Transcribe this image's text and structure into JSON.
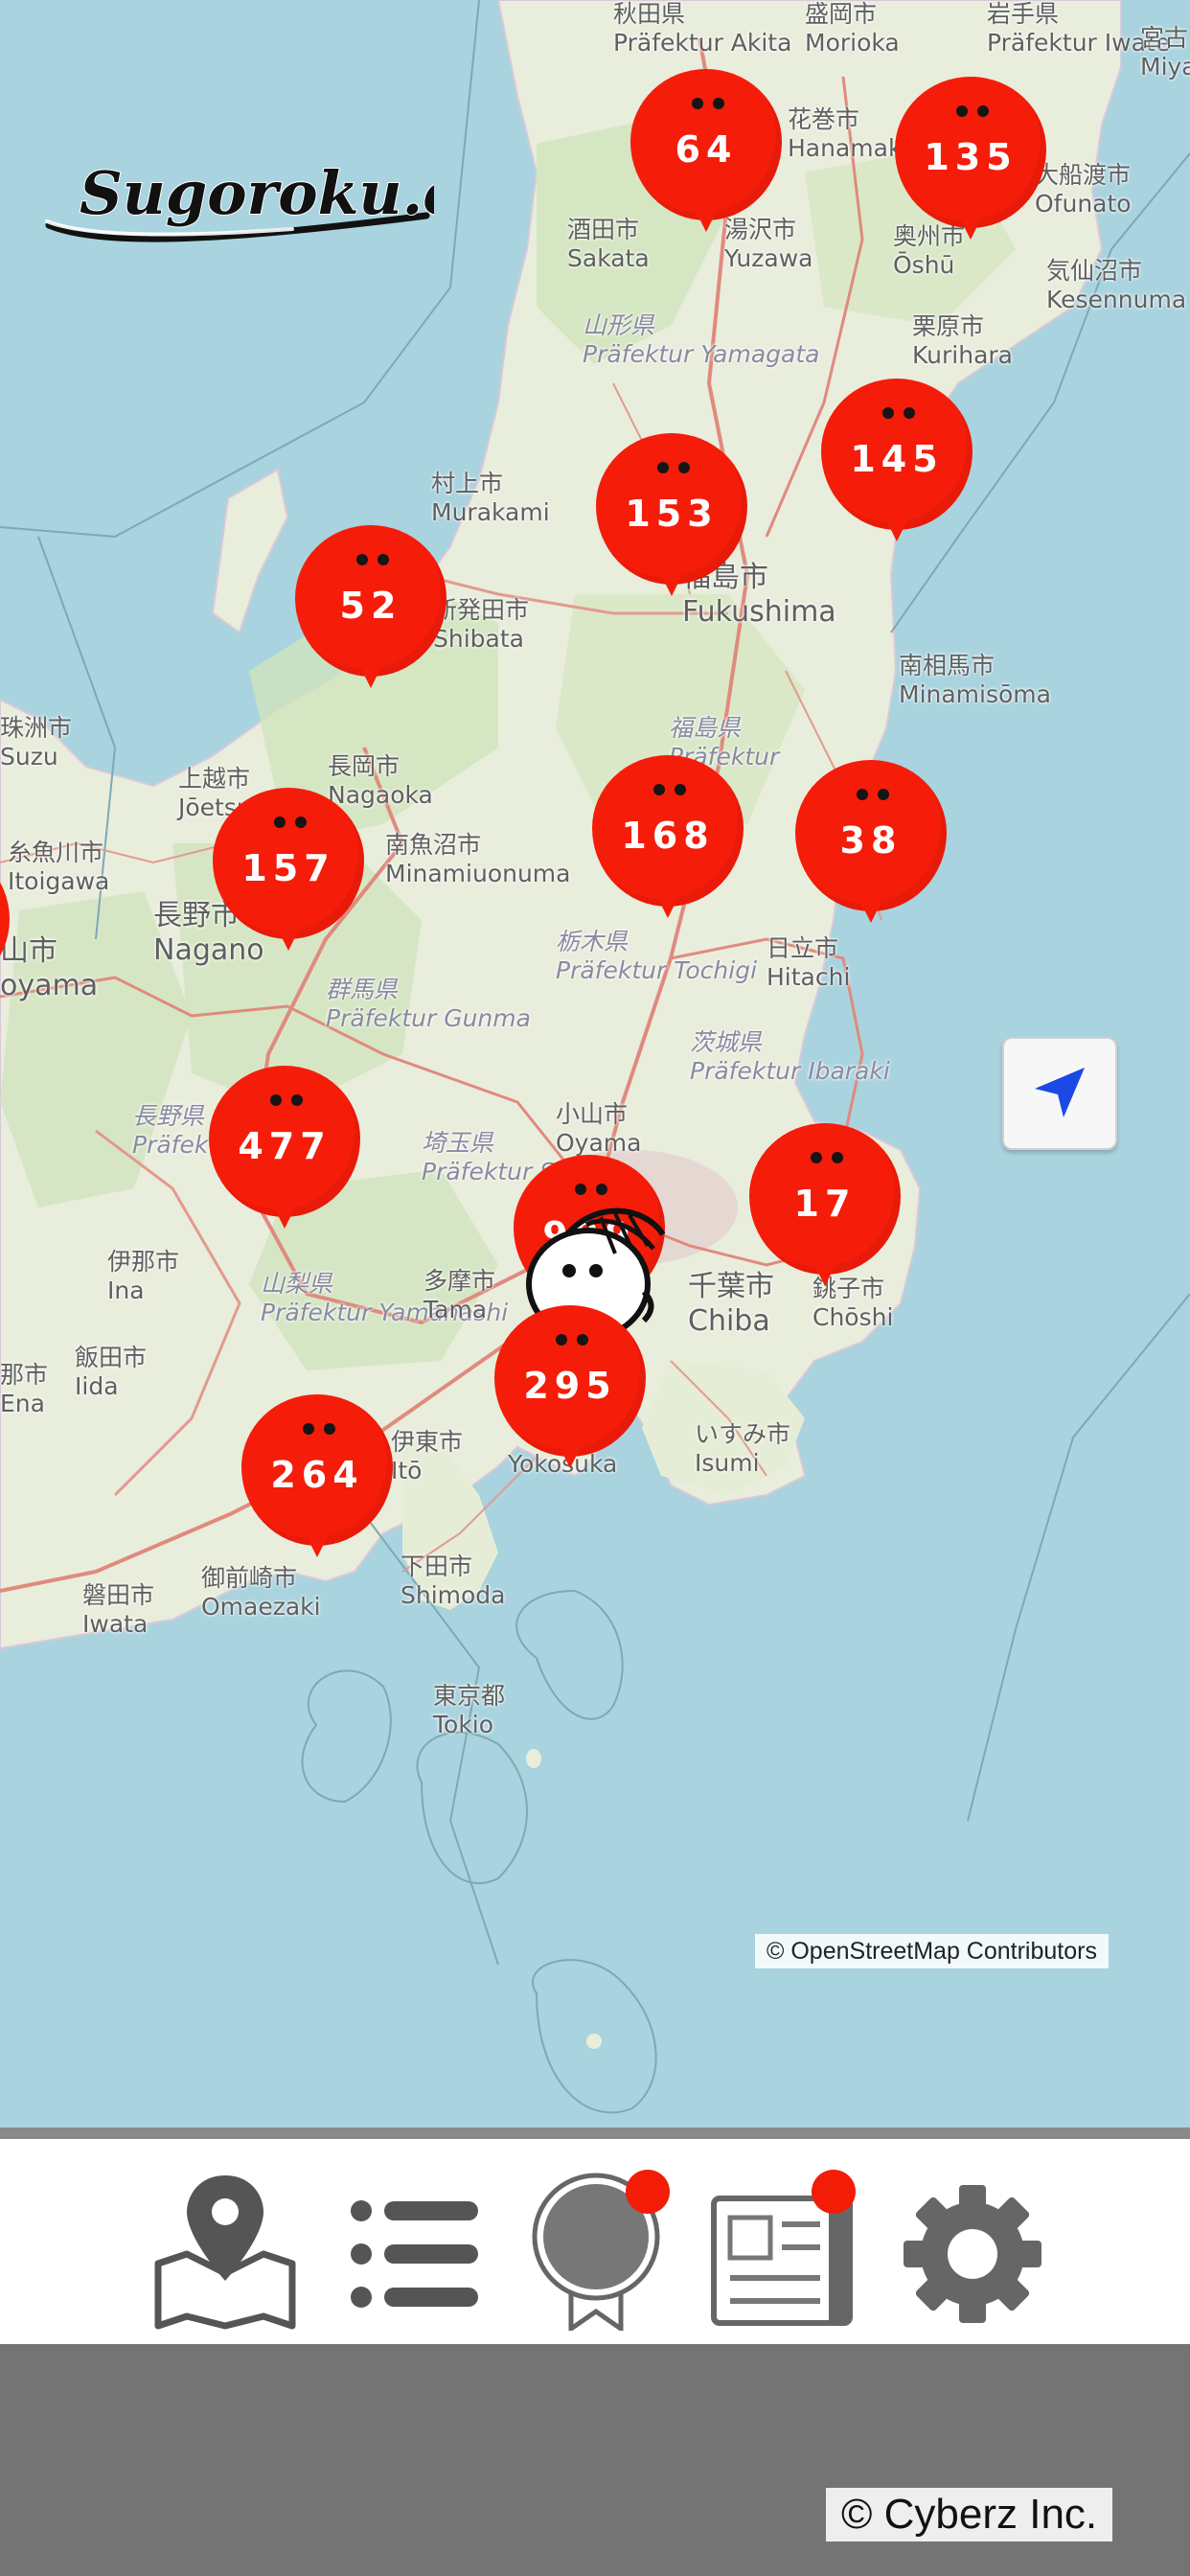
{
  "app": {
    "logo_text": "Sugoroku.com"
  },
  "map": {
    "attribution": "© OpenStreetMap Contributors",
    "labels": [
      {
        "id": "akita",
        "jp": "秋田県",
        "rom": "Präfektur Akita"
      },
      {
        "id": "morioka",
        "jp": "盛岡市",
        "rom": "Morioka"
      },
      {
        "id": "iwate",
        "jp": "岩手県",
        "rom": "Präfektur Iwate"
      },
      {
        "id": "miyako",
        "jp": "宮古",
        "rom": "Miya"
      },
      {
        "id": "hanamaki",
        "jp": "花巻市",
        "rom": "Hanamaki"
      },
      {
        "id": "ofunato",
        "jp": "大船渡市",
        "rom": "Ofunato"
      },
      {
        "id": "sakata",
        "jp": "酒田市",
        "rom": "Sakata"
      },
      {
        "id": "yuzawa",
        "jp": "湯沢市",
        "rom": "Yuzawa"
      },
      {
        "id": "oshu",
        "jp": "奥州市",
        "rom": "Ōshū"
      },
      {
        "id": "kesennuma",
        "jp": "気仙沼市",
        "rom": "Kesennuma"
      },
      {
        "id": "kurihara",
        "jp": "栗原市",
        "rom": "Kurihara"
      },
      {
        "id": "yamagata",
        "jp": "山形県",
        "rom": "Präfektur Yamagata"
      },
      {
        "id": "murakami",
        "jp": "村上市",
        "rom": "Murakami"
      },
      {
        "id": "shibata",
        "jp": "新発田市",
        "rom": "Shibata"
      },
      {
        "id": "fukushima",
        "jp": "福島市",
        "rom": "Fukushima"
      },
      {
        "id": "minamisoma",
        "jp": "南相馬市",
        "rom": "Minamisōma"
      },
      {
        "id": "itoigawa",
        "jp": "糸魚川市",
        "rom": "Itoigawa"
      },
      {
        "id": "joetsu",
        "jp": "上越市",
        "rom": "Jōetsu"
      },
      {
        "id": "nagaoka",
        "jp": "長岡市",
        "rom": "Nagaoka"
      },
      {
        "id": "minamiuonuma",
        "jp": "南魚沼市",
        "rom": "Minamiuonuma"
      },
      {
        "id": "fukushima_pref",
        "jp": "福島県",
        "rom": "Präfektur"
      },
      {
        "id": "nagano",
        "jp": "長野市",
        "rom": "Nagano"
      },
      {
        "id": "toyama",
        "jp": "山市",
        "rom": "oyama"
      },
      {
        "id": "gunma",
        "jp": "群馬県",
        "rom": "Präfektur Gunma"
      },
      {
        "id": "tochigi",
        "jp": "栃木県",
        "rom": "Präfektur Tochigi"
      },
      {
        "id": "hitachi",
        "jp": "日立市",
        "rom": "Hitachi"
      },
      {
        "id": "ibaraki",
        "jp": "茨城県",
        "rom": "Präfektur Ibaraki"
      },
      {
        "id": "oyama",
        "jp": "小山市",
        "rom": "Oyama"
      },
      {
        "id": "saitama",
        "jp": "埼玉県",
        "rom": "Präfektur Saitam"
      },
      {
        "id": "nagano_pref",
        "jp": "長野県",
        "rom": "Präfektur Nagan"
      },
      {
        "id": "ina",
        "jp": "伊那市",
        "rom": "Ina"
      },
      {
        "id": "yamanashi",
        "jp": "山梨県",
        "rom": "Präfektur Yamanashi"
      },
      {
        "id": "tama",
        "jp": "多摩市",
        "rom": "Tama"
      },
      {
        "id": "chiba",
        "jp": "千葉市",
        "rom": "Chiba"
      },
      {
        "id": "choshi",
        "jp": "銚子市",
        "rom": "Chōshi"
      },
      {
        "id": "iida",
        "jp": "飯田市",
        "rom": "Iida"
      },
      {
        "id": "isumi",
        "jp": "いすみ市",
        "rom": "Isumi"
      },
      {
        "id": "ito",
        "jp": "伊東市",
        "rom": "Itō"
      },
      {
        "id": "yokosuka",
        "jp": "",
        "rom": "Yokosuka"
      },
      {
        "id": "shimoda",
        "jp": "下田市",
        "rom": "Shimoda"
      },
      {
        "id": "iwata",
        "jp": "磐田市",
        "rom": "Iwata"
      },
      {
        "id": "omaezaki",
        "jp": "御前崎市",
        "rom": "Omaezaki"
      },
      {
        "id": "tokyo",
        "jp": "東京都",
        "rom": "Tokio"
      },
      {
        "id": "itoshi",
        "jp": "珠洲市",
        "rom": "Suzu"
      },
      {
        "id": "ena",
        "jp": "那市",
        "rom": "Ena"
      }
    ],
    "pins": [
      {
        "id": "akita-pin",
        "count": "64"
      },
      {
        "id": "iwate-pin",
        "count": "135"
      },
      {
        "id": "miyagi-pin",
        "count": "145"
      },
      {
        "id": "yamagata-pin",
        "count": "153"
      },
      {
        "id": "niigata-pin",
        "count": "52"
      },
      {
        "id": "fukushima-pin",
        "count": "168"
      },
      {
        "id": "fukushima-coast-pin",
        "count": "38"
      },
      {
        "id": "nagano-north-pin",
        "count": "157"
      },
      {
        "id": "nagano-south-pin",
        "count": "477"
      },
      {
        "id": "tokyo-pin",
        "count": "999"
      },
      {
        "id": "ibaraki-pin",
        "count": "17"
      },
      {
        "id": "kanagawa-pin",
        "count": "295"
      },
      {
        "id": "shizuoka-pin",
        "count": "264"
      }
    ]
  },
  "nav": {
    "tabs": [
      {
        "id": "map",
        "icon": "map-pin-icon",
        "badge": false
      },
      {
        "id": "list",
        "icon": "list-icon",
        "badge": false
      },
      {
        "id": "medal",
        "icon": "medal-icon",
        "badge": true
      },
      {
        "id": "news",
        "icon": "newspaper-icon",
        "badge": true
      },
      {
        "id": "settings",
        "icon": "gear-icon",
        "badge": false
      }
    ]
  },
  "footer": {
    "copyright": "© Cyberz Inc."
  },
  "colors": {
    "pin": "#f51c0a",
    "sea": "#a9d3df",
    "land": "#e9eddc",
    "badge": "#f21c07",
    "locate_arrow": "#1a49e6"
  }
}
